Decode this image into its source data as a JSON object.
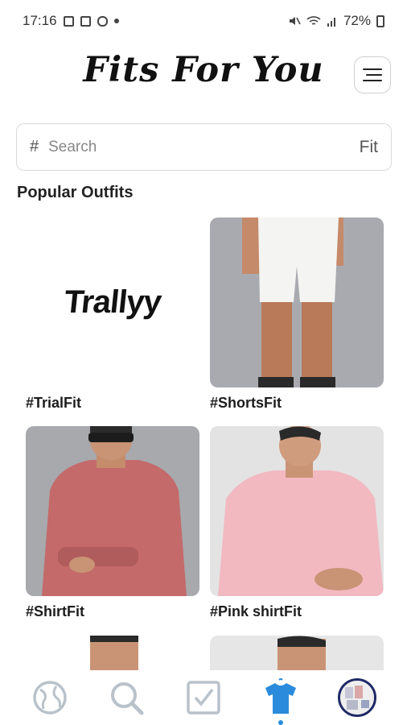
{
  "status_bar": {
    "time": "17:16",
    "battery": "72%"
  },
  "header": {
    "title": "Fits For You"
  },
  "search": {
    "prefix": "#",
    "placeholder": "Search",
    "suffix": "Fit"
  },
  "section": {
    "title": "Popular Outfits"
  },
  "outfits": [
    {
      "label": "#TrialFit",
      "logo_text": "Trallyy"
    },
    {
      "label": "#ShortsFit"
    },
    {
      "label": "#ShirtFit"
    },
    {
      "label": "#Pink shirtFit"
    }
  ],
  "icons": {
    "menu": "menu-icon",
    "nav": [
      "globe-icon",
      "search-icon",
      "checkbox-icon",
      "tshirt-icon",
      "avatar"
    ]
  },
  "colors": {
    "accent": "#2a8bdc",
    "nav_inactive": "#b9c2ca"
  }
}
